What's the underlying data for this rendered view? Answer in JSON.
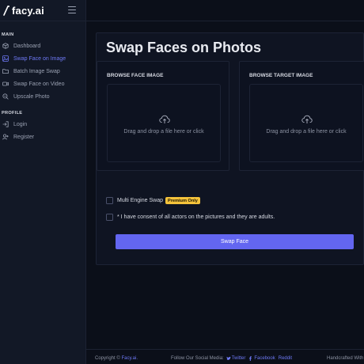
{
  "brand": {
    "name": "facy.ai"
  },
  "sidebar": {
    "main_label": "MAIN",
    "main_items": [
      {
        "label": "Dashboard",
        "icon": "cube-icon"
      },
      {
        "label": "Swap Face on Image",
        "icon": "image-icon",
        "active": true
      },
      {
        "label": "Batch Image Swap",
        "icon": "folder-icon"
      },
      {
        "label": "Swap Face on Video",
        "icon": "video-icon"
      },
      {
        "label": "Upscale Photo",
        "icon": "zoom-icon"
      }
    ],
    "profile_label": "PROFILE",
    "profile_items": [
      {
        "label": "Login",
        "icon": "login-icon"
      },
      {
        "label": "Register",
        "icon": "user-plus-icon"
      }
    ]
  },
  "main": {
    "title": "Swap Faces on Photos",
    "face_upload": {
      "label": "BROWSE FACE IMAGE",
      "dropzone_text": "Drag and drop a file here or click"
    },
    "target_upload": {
      "label": "BROWSE TARGET IMAGE",
      "dropzone_text": "Drag and drop a file here or click"
    },
    "multi_engine": {
      "label": "Multi Engine Swap",
      "badge": "Premium Only"
    },
    "consent": {
      "label": "* I have consent of all actors on the pictures and they are adults."
    },
    "swap_button": "Swap Face"
  },
  "footer": {
    "copyright": "Copyright ©",
    "brand_link": "Facy.ai.",
    "social_label": "Follow Our Social Media:",
    "twitter": "Twitter",
    "facebook": "Facebook",
    "reddit": "Reddit",
    "handcrafted": "Handcrafted With"
  },
  "colors": {
    "accent": "#6366f1",
    "badge": "#f5c33b",
    "background": "#0b0f19"
  }
}
